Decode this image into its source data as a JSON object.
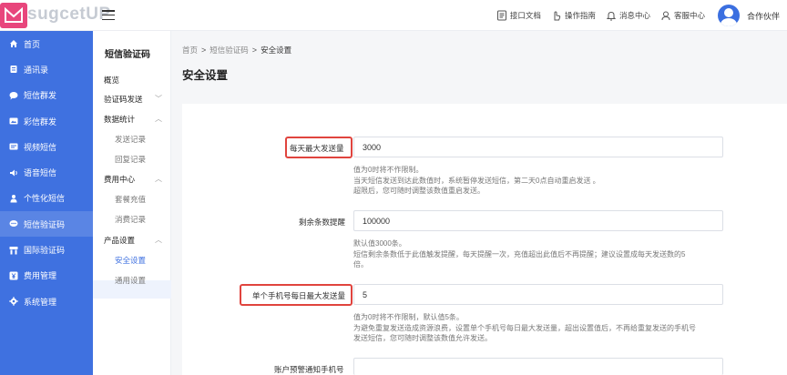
{
  "brand": {
    "logo_text": "sugcetUP",
    "accent": "#3f71e0",
    "logo_color": "#e8467c"
  },
  "header": {
    "actions": [
      {
        "icon": "document-icon",
        "label": "接口文档"
      },
      {
        "icon": "hand-pointer-icon",
        "label": "操作指南"
      },
      {
        "icon": "bell-icon",
        "label": "消息中心"
      },
      {
        "icon": "headset-icon",
        "label": "客服中心"
      }
    ],
    "user_name": "合作伙伴"
  },
  "sidebar": {
    "items": [
      {
        "icon": "home-icon",
        "label": "首页"
      },
      {
        "icon": "contacts-icon",
        "label": "通讯录"
      },
      {
        "icon": "chat-icon",
        "label": "短信群发"
      },
      {
        "icon": "mms-icon",
        "label": "彩信群发"
      },
      {
        "icon": "video-icon",
        "label": "视频短信"
      },
      {
        "icon": "voice-icon",
        "label": "语音短信"
      },
      {
        "icon": "personal-icon",
        "label": "个性化短信"
      },
      {
        "icon": "sms-code-icon",
        "label": "短信验证码",
        "active": true
      },
      {
        "icon": "globe-icon",
        "label": "国际验证码"
      },
      {
        "icon": "yen-icon",
        "label": "费用管理"
      },
      {
        "icon": "settings-icon",
        "label": "系统管理"
      }
    ]
  },
  "submenu": {
    "title": "短信验证码",
    "overview": "概览",
    "code_send": "验证码发送",
    "stats": {
      "label": "数据统计",
      "children": [
        "发送记录",
        "回复记录"
      ]
    },
    "fees": {
      "label": "费用中心",
      "children": [
        "套餐充值",
        "消费记录"
      ]
    },
    "product": {
      "label": "产品设置",
      "children": [
        "安全设置",
        "通用设置"
      ]
    }
  },
  "breadcrumb": [
    "首页",
    "短信验证码",
    "安全设置"
  ],
  "page_title": "安全设置",
  "form": {
    "daily_max": {
      "label": "每天最大发送量",
      "value": "3000",
      "hint": [
        "值为0时将不作限制。",
        "当天短信发送到达此数值时，系统暂停发送短信，第二天0点自动重启发送 。",
        "超限后，您可随时调整该数值重启发送。"
      ]
    },
    "remaining": {
      "label": "剩余条数提醒",
      "value": "100000",
      "hint": [
        "默认值3000条。",
        "短信剩余条数低于此值触发提醒，每天提醒一次，充值超出此值后不再提醒；建议设置成每天发送数的5",
        "倍。"
      ]
    },
    "per_phone": {
      "label": "单个手机号每日最大发送量",
      "value": "5",
      "hint": [
        "值为0时将不作限制，默认值5条。",
        "为避免重复发送造成资源浪费，设置单个手机号每日最大发送量，超出设置值后，不再给重复发送的手机号",
        "发送短信，您可随时调整该数值允许发送。"
      ]
    },
    "alert_phone": {
      "label": "账户预警通知手机号"
    }
  }
}
